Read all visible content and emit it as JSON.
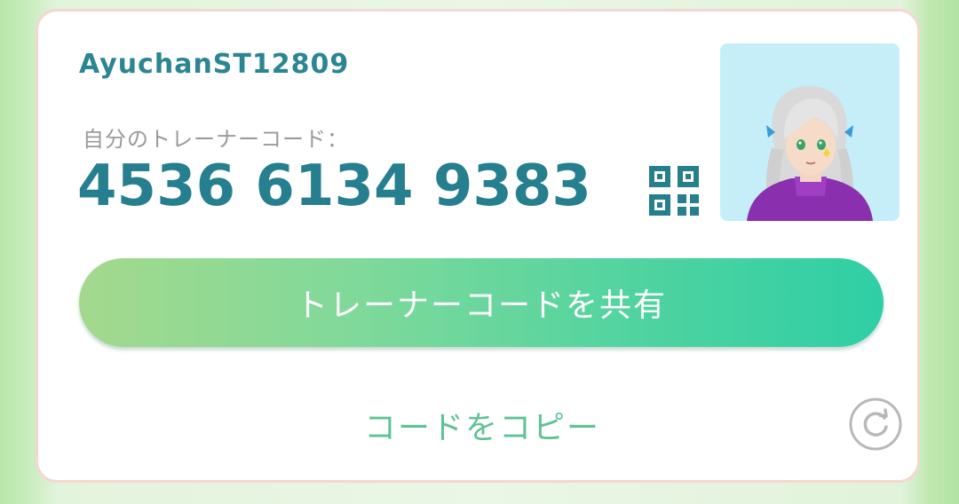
{
  "trainer": {
    "name": "AyuchanST12809",
    "code_label": "自分のトレーナーコード：",
    "code": "4536 6134 9383"
  },
  "actions": {
    "share_label": "トレーナーコードを共有",
    "copy_label": "コードをコピー"
  },
  "icons": {
    "qr": "qr-code-icon",
    "refresh": "refresh-icon",
    "avatar": "trainer-avatar"
  },
  "colors": {
    "name_text": "#2b8593",
    "code_text": "#267f8e",
    "copy_text": "#5ec394",
    "share_gradient_start": "#a4d98d",
    "share_gradient_end": "#2ecfa5",
    "card_border": "#f5d6d2",
    "avatar_bg": "#c5eef8"
  }
}
